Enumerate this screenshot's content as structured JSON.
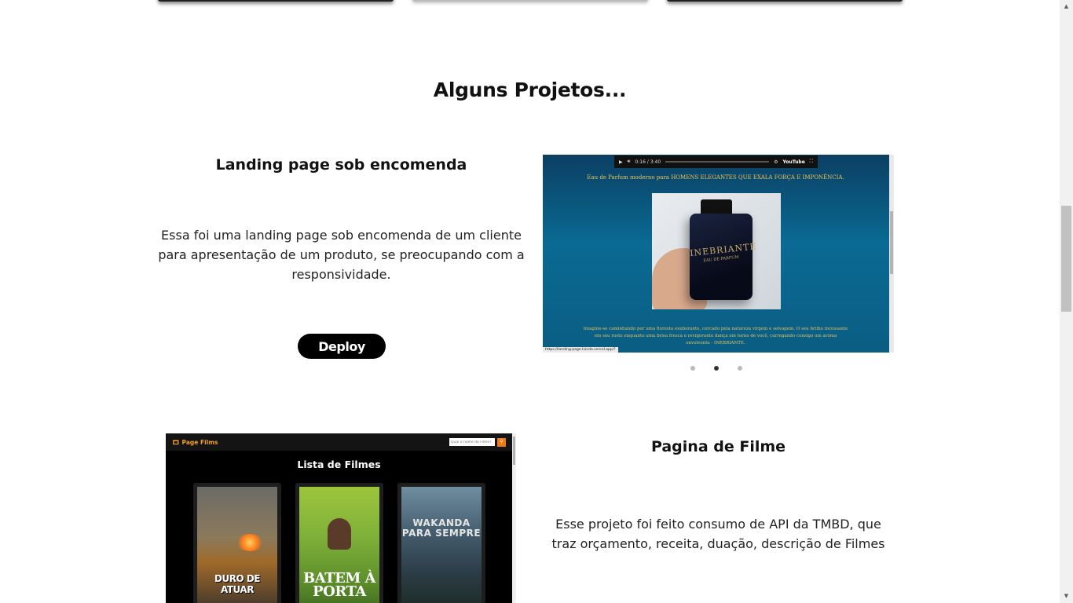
{
  "section": {
    "title": "Alguns Projetos..."
  },
  "projects": [
    {
      "title": "Landing page sob encomenda",
      "description": "Essa foi uma landing page sob encomenda de um cliente para apresentação de um produto, se preocupando com a responsividade.",
      "button_label": "Deploy",
      "carousel": {
        "video_time": "0:16 / 3:40",
        "video_brand": "YouTube",
        "headline": "Eau de Parfum moderno para HOMENS ELEGANTES QUE EXALA FORÇA E IMPONÊNCIA.",
        "product_name": "INEBRIANTE",
        "product_sub": "EAU DE PARFUM",
        "body": "Imagine-se caminhando por uma floresta exuberante, cercado pela natureza virgem e selvagem. O seu brilho incessante em seu rosto enquanto uma brisa fresca e revigorante dança em torno de você, carregando consigo um aroma envolvente - INEBRIANTE.",
        "url": "https://landing-page.lvinda.vercel.app/?",
        "next_icon": "chevron-right-icon",
        "slide_count": 3,
        "active_slide": 2
      }
    },
    {
      "title": "Pagina de Filme",
      "description": "Esse projeto foi feito consumo de API da TMBD, que traz orçamento, receita, duação, descrição de Filmes",
      "screenshot": {
        "brand": "Page Films",
        "search_placeholder": "Qual o nome do Filme?",
        "search_icon": "search-icon",
        "list_title": "Lista de Filmes",
        "movies": [
          {
            "title": "DURO DE ATUAR"
          },
          {
            "title": "BATEM À PORTA"
          },
          {
            "title": "WAKANDA PARA SEMPRE"
          }
        ]
      }
    }
  ],
  "colors": {
    "button_bg": "#000000",
    "accent_orange": "#f07a10",
    "carousel_gold": "#e6c35a"
  }
}
